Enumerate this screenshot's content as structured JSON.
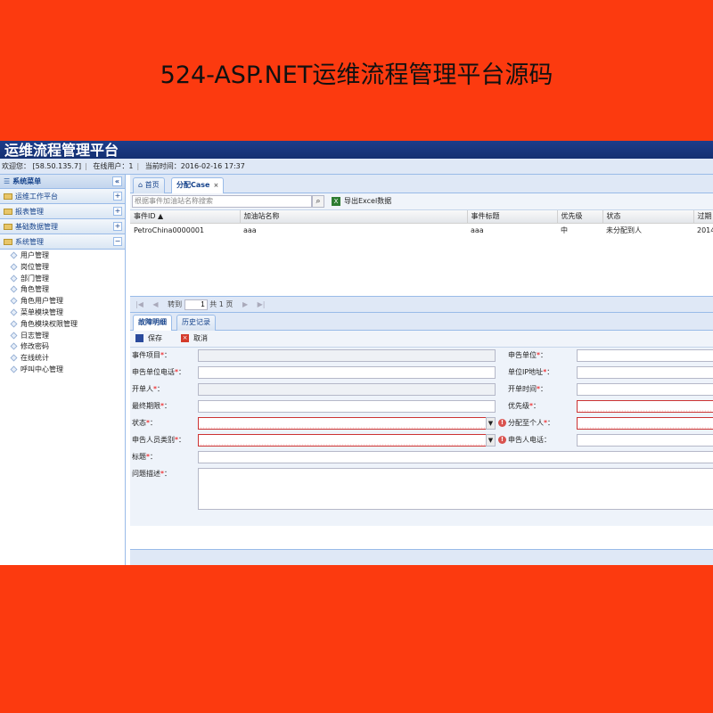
{
  "banner": {
    "title": "524-ASP.NET运维流程管理平台源码"
  },
  "app": {
    "title": "运维流程管理平台"
  },
  "status": {
    "welcome": "欢迎您：",
    "ip": "[58.50.135.7]",
    "online": "在线用户：1",
    "time": "当前时间：2016-02-16 17:37"
  },
  "sidebar": {
    "title": "系统菜单",
    "collapse": "«",
    "sections": [
      {
        "label": "运维工作平台",
        "toggle": "+"
      },
      {
        "label": "报表管理",
        "toggle": "+"
      },
      {
        "label": "基础数据管理",
        "toggle": "+"
      },
      {
        "label": "系统管理",
        "toggle": "−"
      }
    ],
    "items": [
      "用户管理",
      "岗位管理",
      "部门管理",
      "角色管理",
      "角色用户管理",
      "菜单模块管理",
      "角色模块权限管理",
      "日志管理",
      "修改密码",
      "在线统计",
      "呼叫中心管理"
    ]
  },
  "tabs": {
    "home": "首页",
    "assign": "分配Case",
    "close": "×"
  },
  "toolbar": {
    "search_placeholder": "根据事件加油站名称搜索",
    "search_icon": "⌕",
    "export": "导出Excel数据",
    "excel_icon": "X"
  },
  "grid": {
    "columns": [
      "事件ID ▲",
      "加油站名称",
      "事件标题",
      "优先级",
      "状态",
      "过期"
    ],
    "rows": [
      [
        "PetroChina0000001",
        "aaa",
        "aaa",
        "中",
        "未分配到人",
        "2014"
      ]
    ]
  },
  "pager": {
    "first": "|◀",
    "prev": "◀",
    "goto": "转到",
    "page": "1",
    "total": "共 1 页",
    "next": "▶",
    "last": "▶|"
  },
  "detail_tabs": {
    "fault": "故障明细",
    "history": "历史记录"
  },
  "form_toolbar": {
    "save": "保存",
    "cancel": "取消"
  },
  "form": {
    "item": "事件项目",
    "reporter_unit": "申告单位",
    "reporter_phone": "申告单位电话",
    "unit_ip": "单位IP地址",
    "opener": "开单人",
    "open_time": "开单时间",
    "deadline": "最终期限",
    "priority": "优先级",
    "state": "状态",
    "assign_to": "分配至个人",
    "reporter_type": "申告人员类别",
    "reporter_tel": "申告人电话",
    "title": "标题",
    "desc": "问题描述",
    "req": "*",
    "colon": "："
  }
}
